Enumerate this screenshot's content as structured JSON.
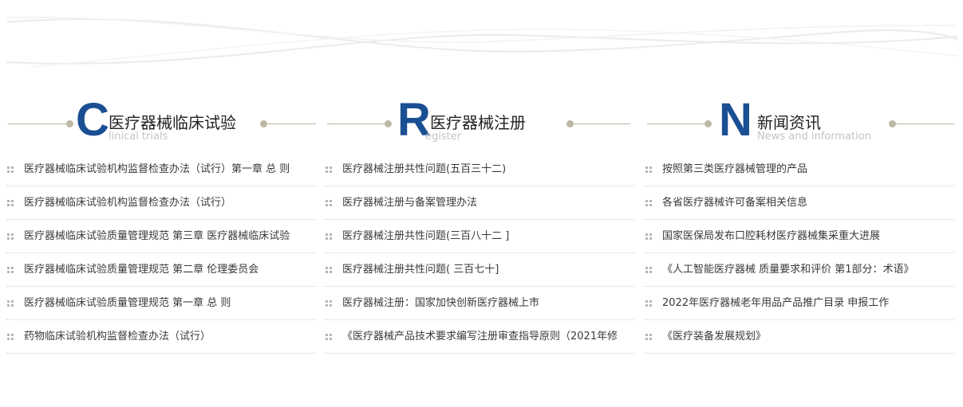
{
  "columns": [
    {
      "letter": "C",
      "title": "医疗器械临床试验",
      "subtitle": "linical trials",
      "items": [
        "医疗器械临床试验机构监督检查办法（试行）第一章 总 则",
        "医疗器械临床试验机构监督检查办法（试行）",
        "医疗器械临床试验质量管理规范 第三章 医疗器械临床试验",
        "医疗器械临床试验质量管理规范 第二章 伦理委员会",
        "医疗器械临床试验质量管理规范 第一章 总 则",
        "药物临床试验机构监督检查办法（试行）"
      ]
    },
    {
      "letter": "R",
      "title": "医疗器械注册",
      "subtitle": "egister",
      "items": [
        "医疗器械注册共性问题(五百三十二)",
        "医疗器械注册与备案管理办法",
        "医疗器械注册共性问题(三百八十二 ]",
        "医疗器械注册共性问题( 三百七十]",
        "医疗器械注册：国家加快创新医疗器械上市",
        "《医疗器械产品技术要求编写注册审查指导原则（2021年修"
      ]
    },
    {
      "letter": "N",
      "title": "新闻资讯",
      "subtitle": "News and information",
      "items": [
        "按照第三类医疗器械管理的产品",
        "各省医疗器械许可备案相关信息",
        "国家医保局发布口腔耗材医疗器械集采重大进展",
        "《人工智能医疗器械 质量要求和评价 第1部分：术语》",
        "2022年医疗器械老年用品产品推广目录 申报工作",
        "《医疗装备发展规划》"
      ]
    }
  ],
  "colors": {
    "accent": "#1a4f93",
    "decoration": "#bdb7a6",
    "subtitle": "#c4c4c4",
    "text": "#3a3a3a"
  }
}
